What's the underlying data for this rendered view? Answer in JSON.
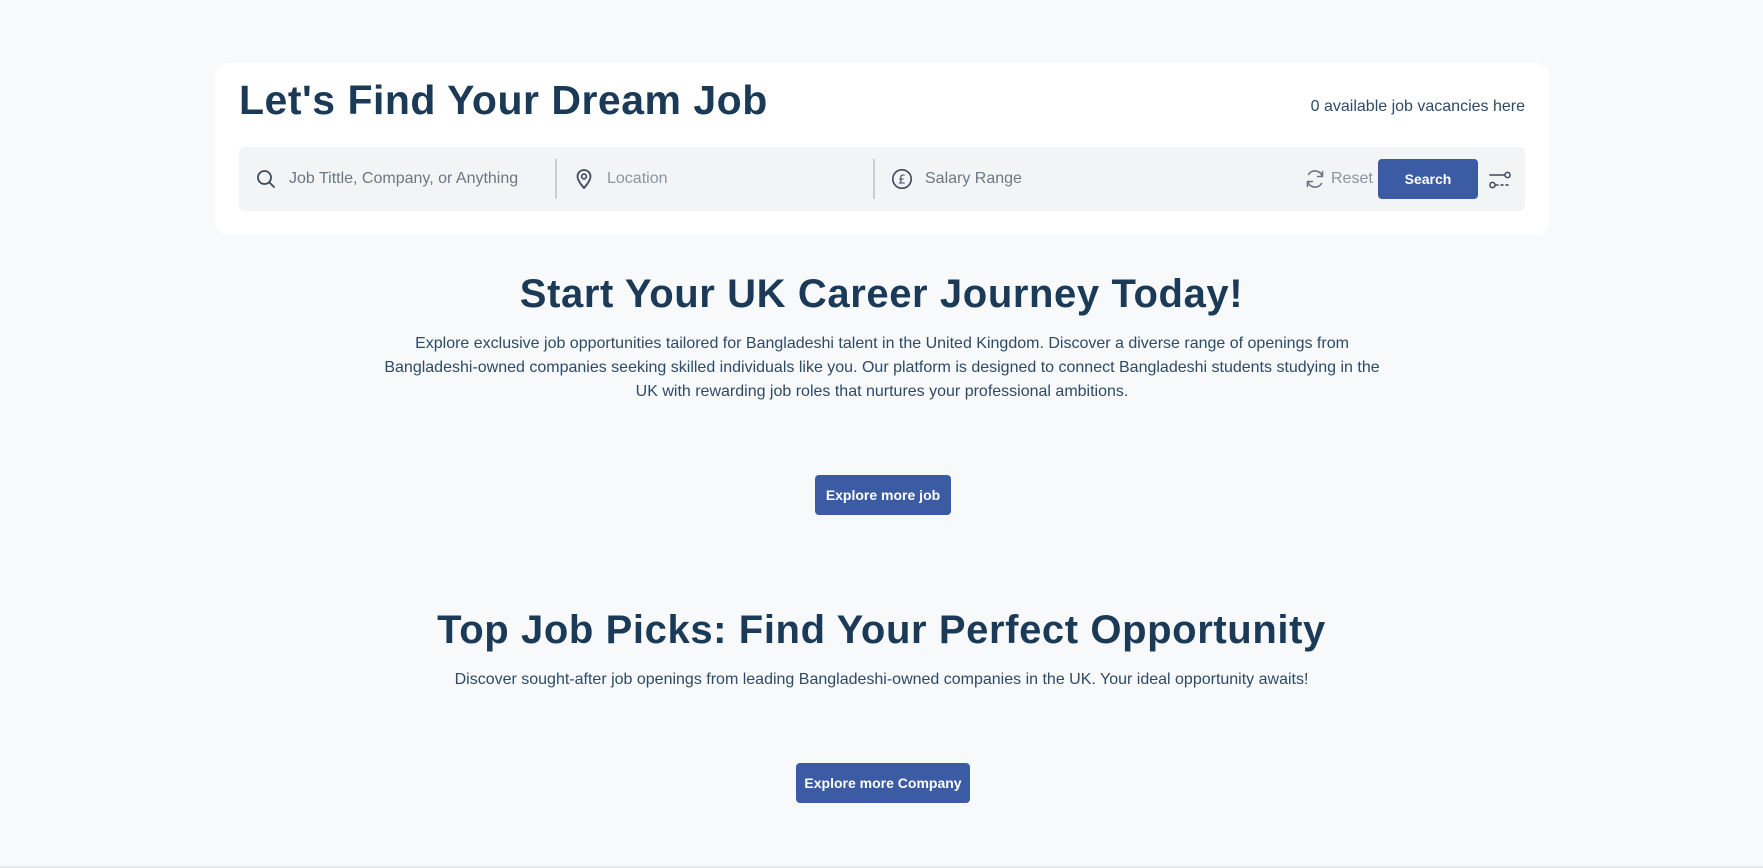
{
  "search_card": {
    "title": "Let's Find Your Dream Job",
    "vacancy_text": "0 available job vacancies here",
    "keyword_placeholder": "Job Tittle, Company, or Anything",
    "location_placeholder": "Location",
    "salary_placeholder": "Salary Range",
    "reset_label": "Reset",
    "search_label": "Search",
    "icons": {
      "keyword": "search-icon",
      "location": "map-pin-icon",
      "salary": "pound-icon",
      "reset": "refresh-icon",
      "filter": "filter-sliders-icon"
    }
  },
  "career_section": {
    "title": "Start Your UK Career Journey Today!",
    "description": "Explore exclusive job opportunities tailored for Bangladeshi talent in the United Kingdom. Discover a diverse range of openings from Bangladeshi-owned companies seeking skilled individuals like you. Our platform is designed to connect Bangladeshi students studying in the UK with rewarding job roles that nurtures your professional ambitions.",
    "button_label": "Explore more job"
  },
  "picks_section": {
    "title": "Top Job Picks: Find Your Perfect Opportunity",
    "description": "Discover sought-after job openings from leading Bangladeshi-owned companies in the UK. Your ideal opportunity awaits!",
    "button_label": "Explore more Company"
  },
  "colors": {
    "background": "#f7f9fb",
    "heading": "#1b3a57",
    "primary_button": "#3b5ba5",
    "search_bar": "#f3f4f6"
  }
}
